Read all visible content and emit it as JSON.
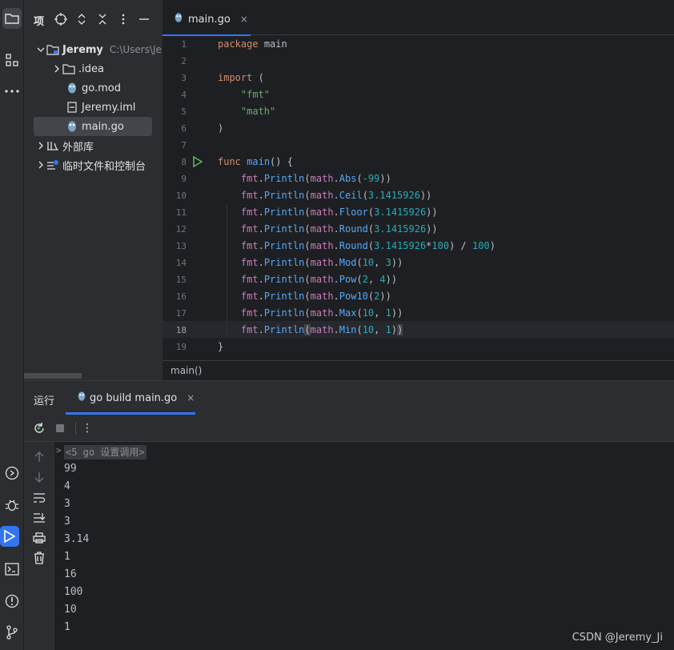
{
  "project": {
    "title": "项",
    "root_name": "Jeremy",
    "root_path": "C:\\Users\\Jer",
    "items": [
      {
        "label": ".idea"
      },
      {
        "label": "go.mod"
      },
      {
        "label": "Jeremy.iml"
      },
      {
        "label": "main.go"
      },
      {
        "label": "外部库"
      },
      {
        "label": "临时文件和控制台"
      }
    ]
  },
  "editor": {
    "tab_label": "main.go",
    "tab_close": "×",
    "breadcrumb": "main()",
    "line_numbers": [
      "1",
      "2",
      "3",
      "4",
      "5",
      "6",
      "7",
      "8",
      "9",
      "10",
      "11",
      "12",
      "13",
      "14",
      "15",
      "16",
      "17",
      "18",
      "19"
    ],
    "current_line": "18",
    "code": {
      "l1_kw": "package",
      "l1_name": "main",
      "l3_kw": "import",
      "l3_paren": " (",
      "l4": "\"fmt\"",
      "l5": "\"math\"",
      "l6": ")",
      "l8_kw": "func",
      "l8_fn": "main",
      "l8_rest": "() {",
      "calls": [
        {
          "fn": "Abs",
          "args": [
            "-99"
          ],
          "tail": "))"
        },
        {
          "fn": "Ceil",
          "args": [
            "3.1415926"
          ],
          "tail": "))"
        },
        {
          "fn": "Floor",
          "args": [
            "3.1415926"
          ],
          "tail": "))"
        },
        {
          "fn": "Round",
          "args": [
            "3.1415926"
          ],
          "tail": "))"
        },
        {
          "fn": "Round",
          "args": [
            "3.1415926",
            "100",
            "100"
          ],
          "tail": ""
        },
        {
          "fn": "Mod",
          "args": [
            "10",
            "3"
          ],
          "tail": "))"
        },
        {
          "fn": "Pow",
          "args": [
            "2",
            "4"
          ],
          "tail": "))"
        },
        {
          "fn": "Pow10",
          "args": [
            "2"
          ],
          "tail": "))"
        },
        {
          "fn": "Max",
          "args": [
            "10",
            "1"
          ],
          "tail": "))"
        },
        {
          "fn": "Min",
          "args": [
            "10",
            "1"
          ],
          "tail": "))"
        }
      ],
      "l19": "}",
      "pkg_fmt": "fmt",
      "println": "Println",
      "pkg_math": "math"
    }
  },
  "run": {
    "label": "运行",
    "tab_label": "go build main.go",
    "tab_close": "×",
    "more": "⋮",
    "fold_text": "<5 go 设置调用>",
    "output": [
      "99",
      "4",
      "3",
      "3",
      "3.14",
      "1",
      "16",
      "100",
      "10",
      "1"
    ]
  },
  "watermark": "CSDN @Jeremy_Ji",
  "colors": {
    "accent": "#3574f0",
    "keyword": "#cf8e6d",
    "string": "#6aab73",
    "number": "#2aacb8",
    "function": "#56a8f5",
    "package": "#c77dbb",
    "run_green": "#5fb865"
  }
}
